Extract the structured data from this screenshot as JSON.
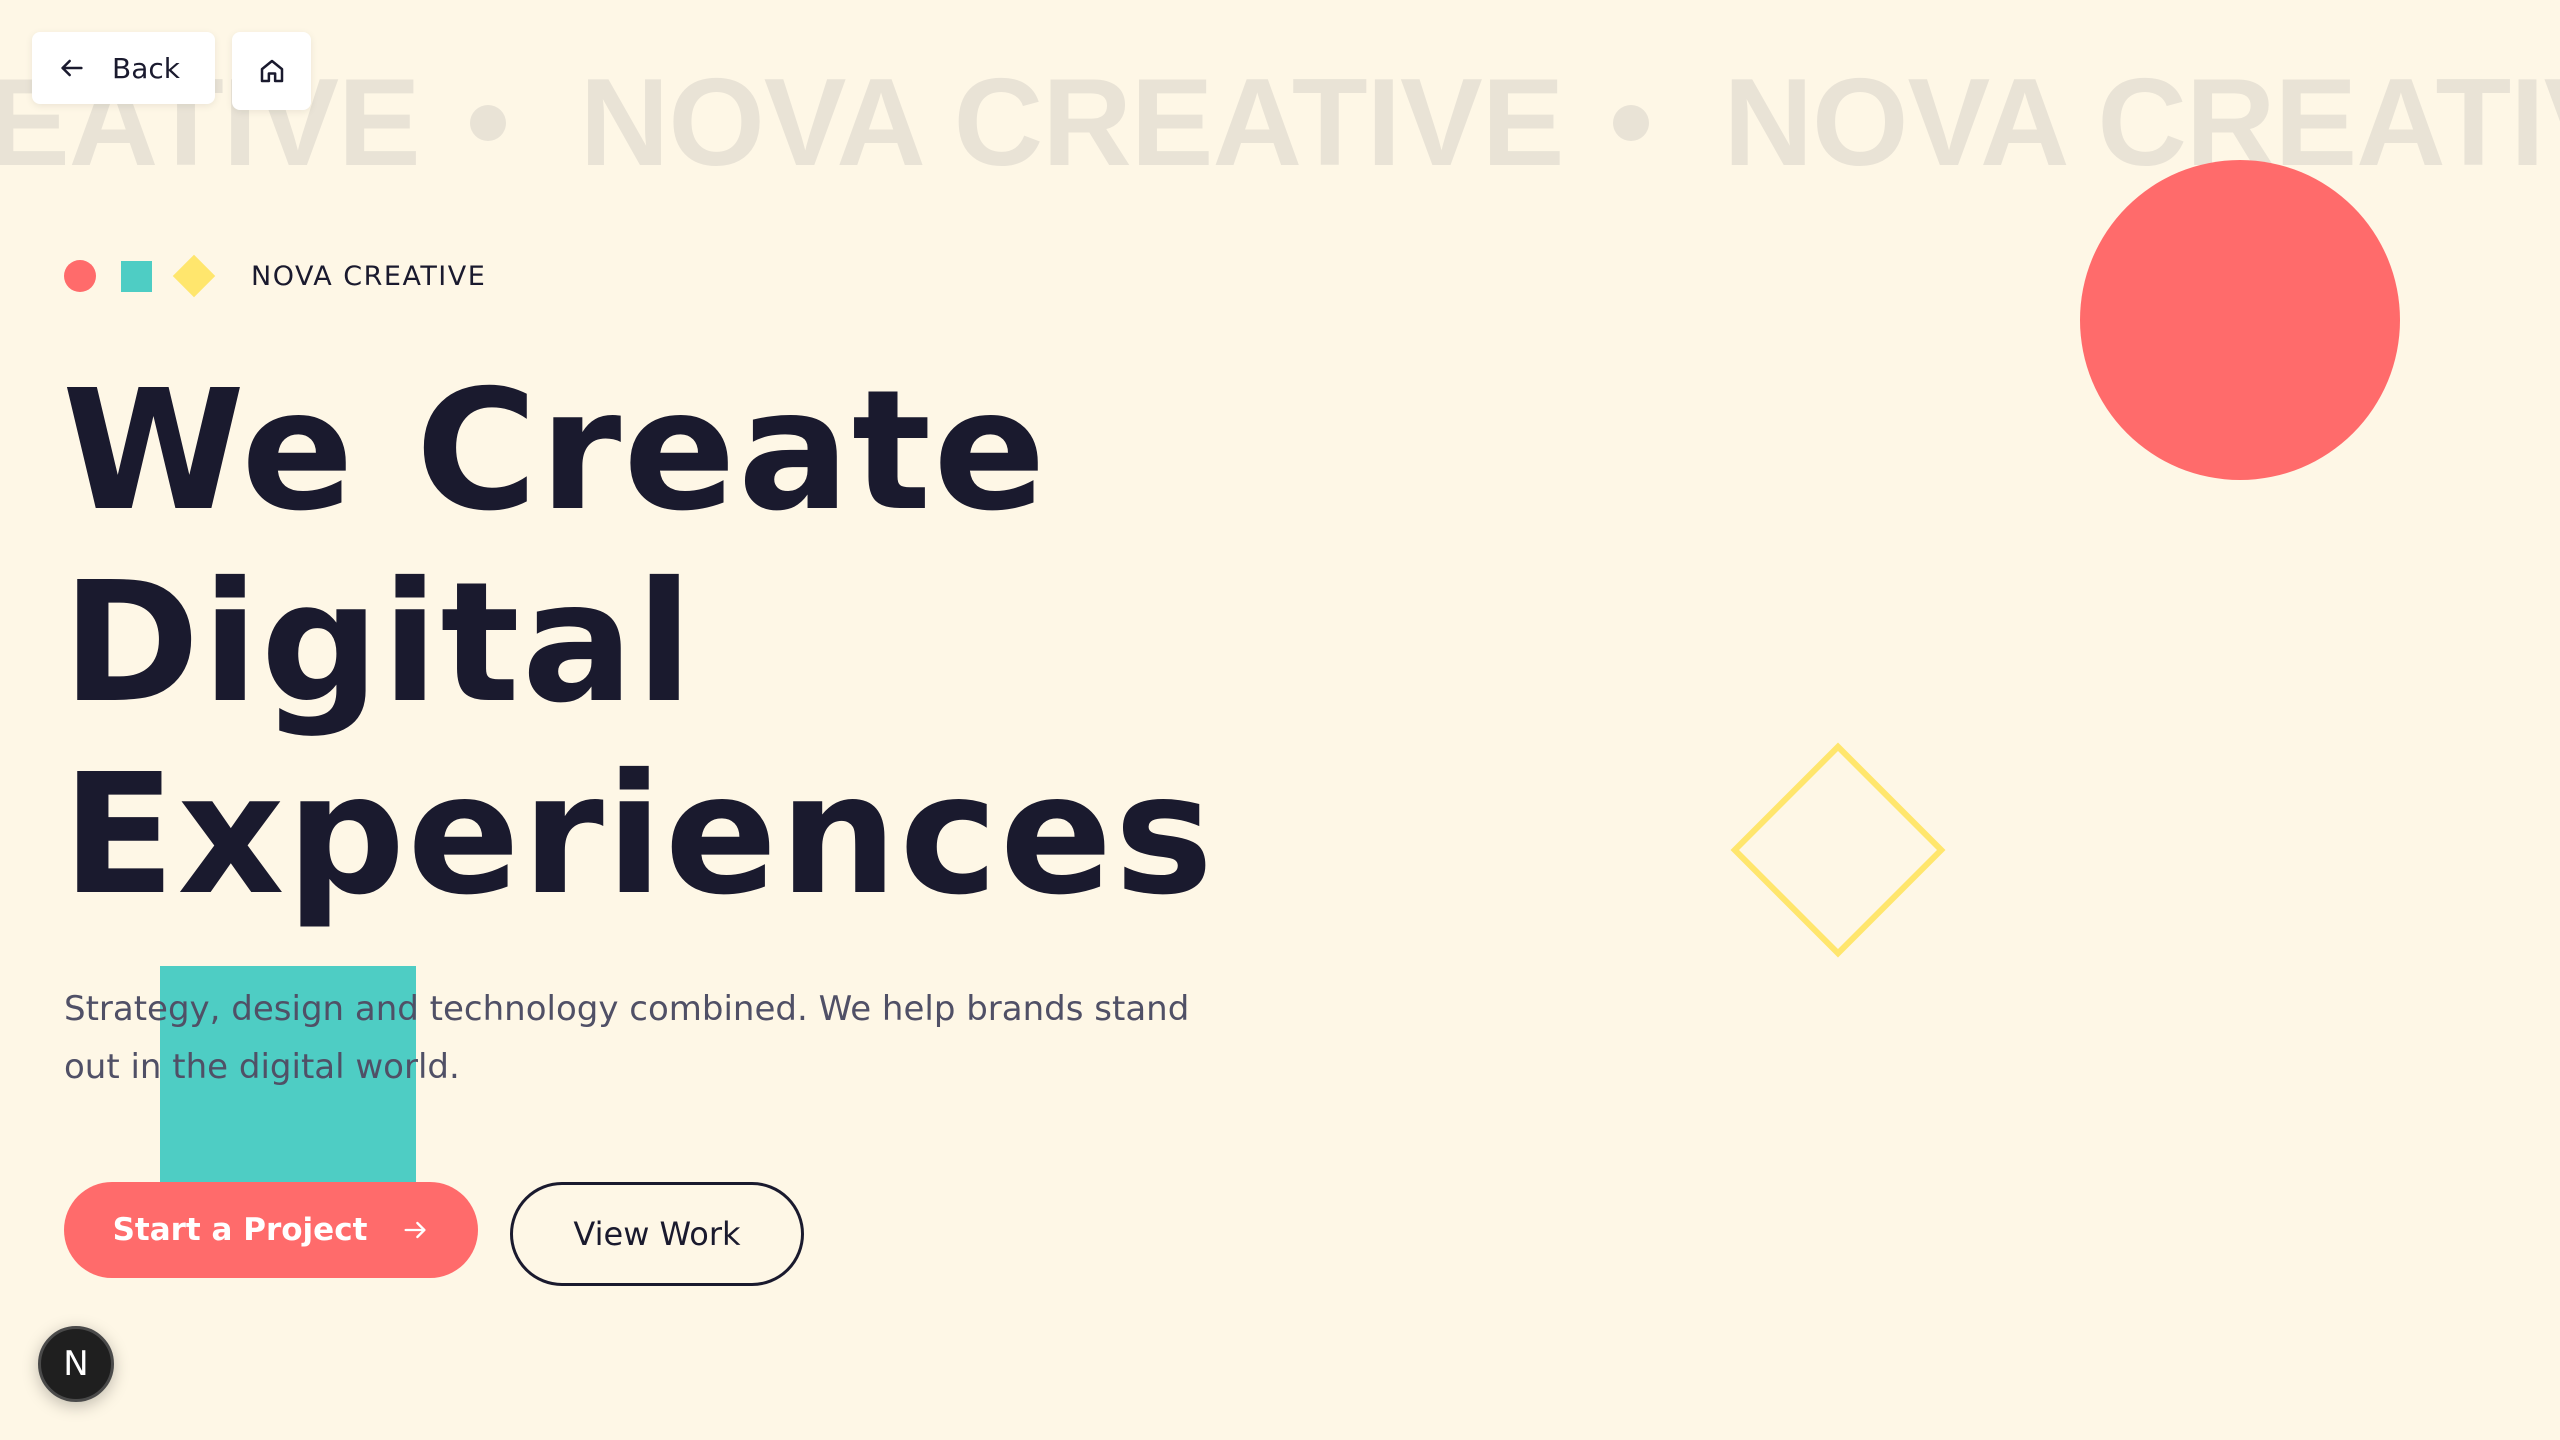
{
  "marquee": {
    "text": "NOVA CREATIVE",
    "repeat": [
      "CREATIVE",
      "NOVA CREATIVE",
      "NOVA CREATIVE"
    ]
  },
  "nav": {
    "back_label": "Back",
    "back_icon": "arrow-left-icon",
    "home_icon": "home-icon"
  },
  "brand": {
    "name": "NOVA CREATIVE"
  },
  "hero": {
    "line1": "We Create",
    "line2": "Digital",
    "line3": "Experiences",
    "subtitle_line1": "Strategy, design and technology combined. We help brands stand",
    "subtitle_line2": "out in the digital world."
  },
  "cta": {
    "primary_label": "Start a Project",
    "primary_icon": "arrow-right-icon",
    "secondary_label": "View Work"
  },
  "badge": {
    "letter": "N"
  },
  "colors": {
    "background": "#FEF7E6",
    "coral": "#FF6B6B",
    "teal": "#4ECDC4",
    "yellow": "#FFE66D",
    "navy": "#1A1A2E",
    "marquee": "#E9E3D6"
  }
}
